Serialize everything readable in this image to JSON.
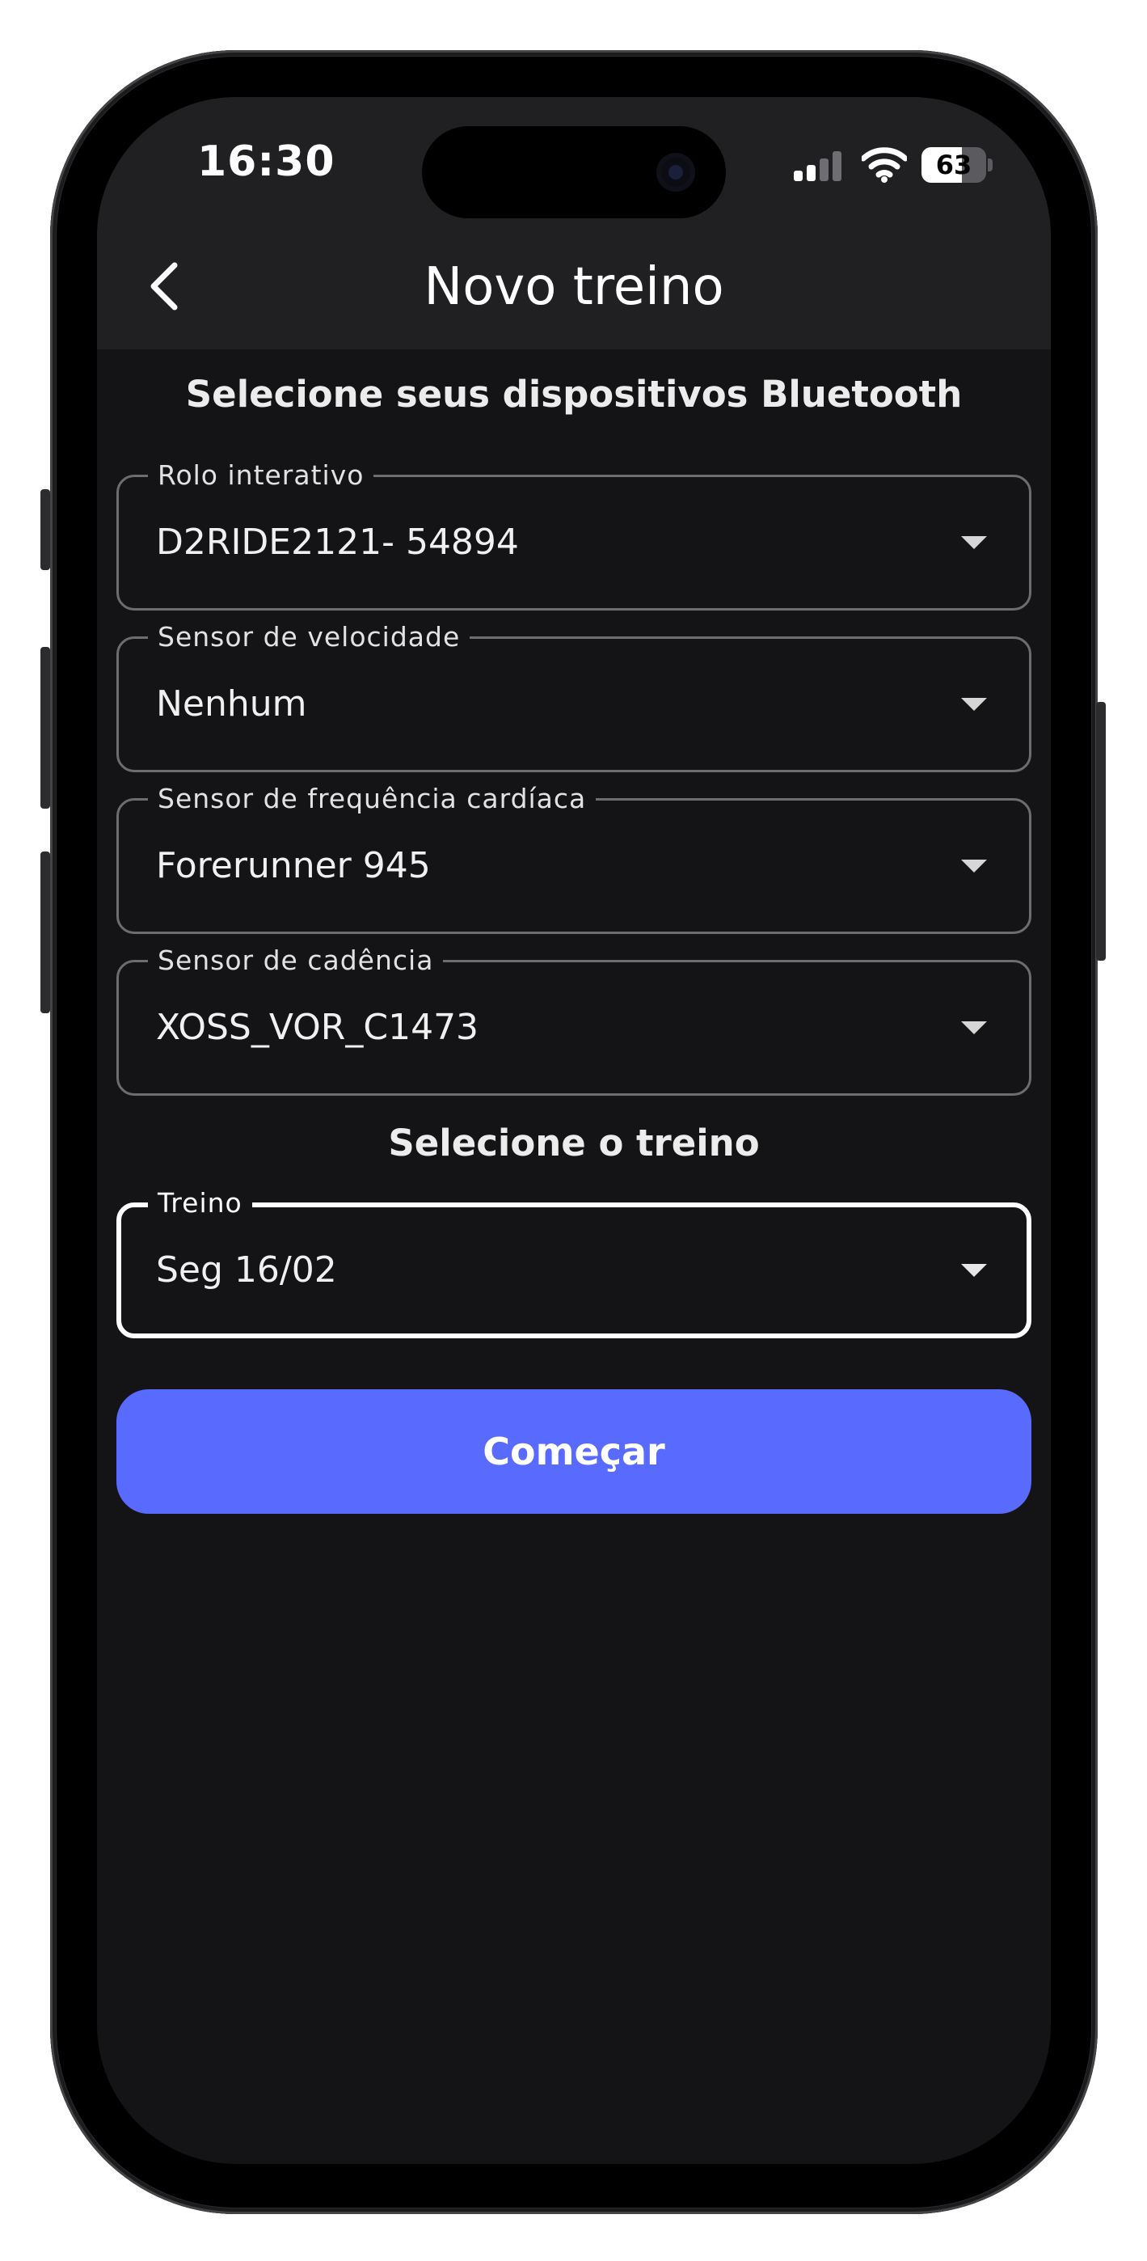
{
  "status_bar": {
    "time": "16:30",
    "battery_level": "63",
    "battery_fraction": 0.63,
    "signal_bars_active": 2,
    "signal_bars_total": 4
  },
  "header": {
    "title": "Novo treino",
    "back_icon": "chevron-left-icon"
  },
  "devices_section": {
    "heading": "Selecione seus dispositivos Bluetooth",
    "fields": [
      {
        "label": "Rolo interativo",
        "value": "D2RIDE2121- 54894"
      },
      {
        "label": "Sensor de velocidade",
        "value": "Nenhum"
      },
      {
        "label": "Sensor de frequência cardíaca",
        "value": "Forerunner 945"
      },
      {
        "label": "Sensor de cadência",
        "value": "XOSS_VOR_C1473"
      }
    ]
  },
  "workout_section": {
    "heading": "Selecione o treino",
    "field": {
      "label": "Treino",
      "value": "Seg 16/02"
    }
  },
  "start_button": {
    "label": "Começar"
  },
  "colors": {
    "accent": "#596bff",
    "background": "#141416",
    "header_background": "#202022",
    "field_border": "#6d6d71",
    "focused_border": "#ffffff"
  }
}
